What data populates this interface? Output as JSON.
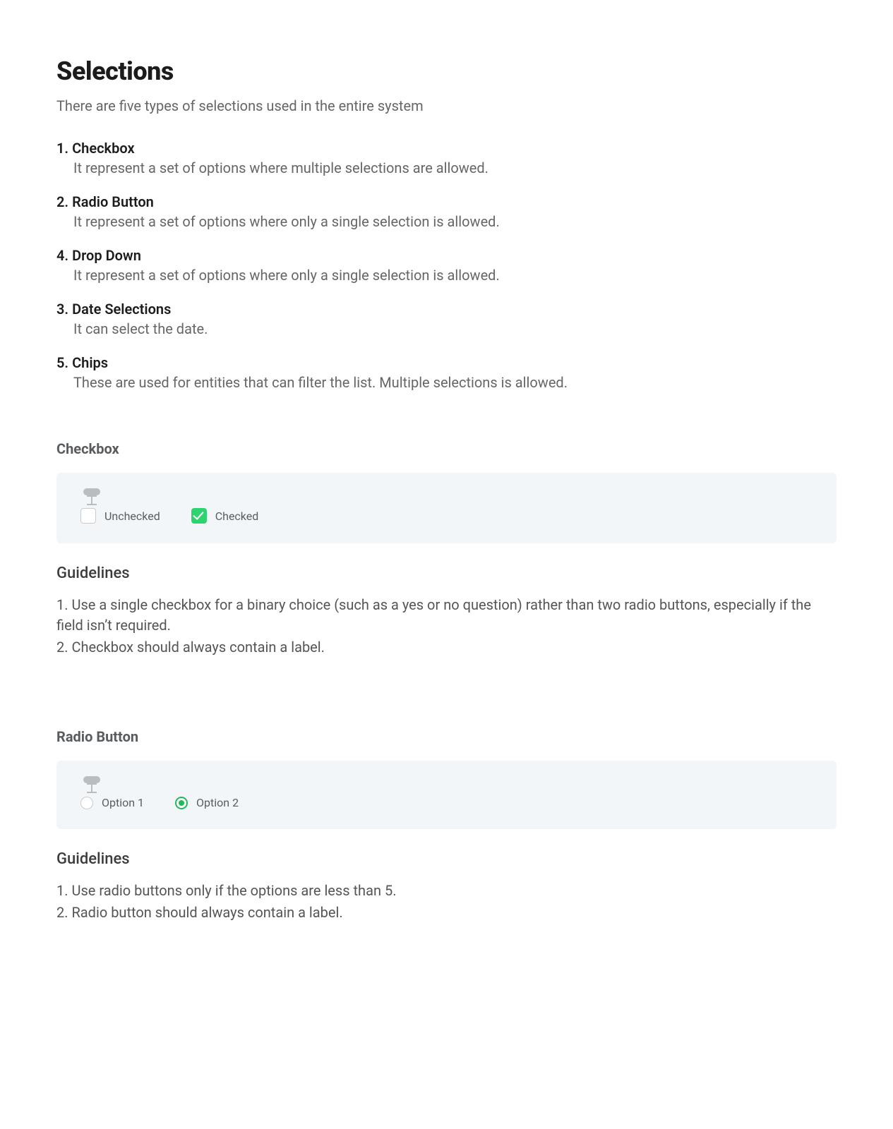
{
  "title": "Selections",
  "intro": "There are five types of selections used in the entire system",
  "types": [
    {
      "num": "1.",
      "title": "Checkbox",
      "desc": "It represent a set of options where multiple selections are allowed."
    },
    {
      "num": "2.",
      "title": "Radio Button",
      "desc": "It represent a set of options where only a single selection is allowed."
    },
    {
      "num": "4.",
      "title": "Drop Down",
      "desc": "It represent a set of options where only a single selection is allowed."
    },
    {
      "num": "3.",
      "title": "Date Selections",
      "desc": "It can select the date."
    },
    {
      "num": "5.",
      "title": "Chips",
      "desc": "These are used for entities that can filter the list. Multiple selections is allowed."
    }
  ],
  "checkbox_section": {
    "heading": "Checkbox",
    "unchecked_label": "Unchecked",
    "checked_label": "Checked",
    "guidelines_heading": "Guidelines",
    "guidelines": [
      "1. Use a single checkbox for a binary choice (such as a yes or no question) rather than two radio buttons, especially if the field isn’t required.",
      "2. Checkbox should always contain a label."
    ]
  },
  "radio_section": {
    "heading": "Radio Button",
    "option1_label": "Option 1",
    "option2_label": "Option 2",
    "guidelines_heading": "Guidelines",
    "guidelines": [
      "1. Use radio buttons only if the  options are less than 5.",
      "2. Radio button should always contain a label."
    ]
  }
}
